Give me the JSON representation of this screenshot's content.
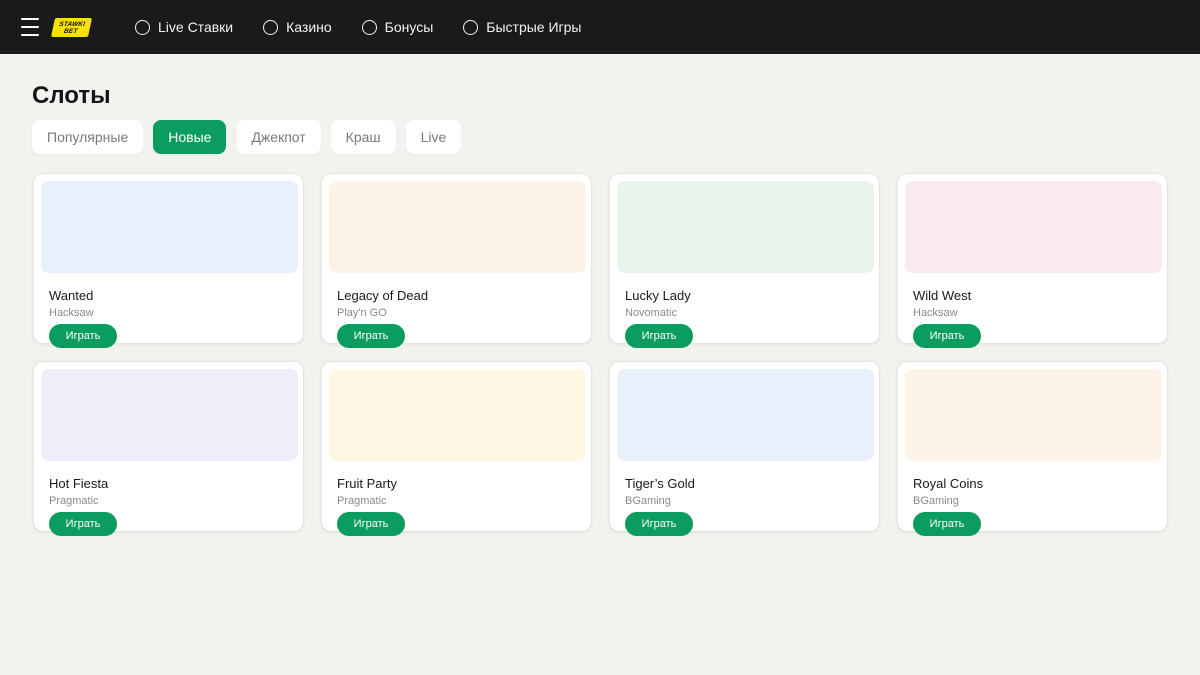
{
  "header": {
    "logo_lines": [
      "STAWKI",
      "BET"
    ],
    "nav": [
      {
        "label": "Live Ставки"
      },
      {
        "label": "Казино"
      },
      {
        "label": "Бонусы"
      },
      {
        "label": "Быстрые Игры"
      }
    ]
  },
  "page_title": "Слоты",
  "tabs": [
    {
      "label": "Популярные",
      "active": false
    },
    {
      "label": "Новые",
      "active": true
    },
    {
      "label": "Джекпот",
      "active": false
    },
    {
      "label": "Краш",
      "active": false
    },
    {
      "label": "Live",
      "active": false
    }
  ],
  "play_label": "Играть",
  "games": [
    {
      "title": "Wanted",
      "provider": "Hacksaw",
      "color": "#e9f0fb"
    },
    {
      "title": "Legacy of Dead",
      "provider": "Play'n GO",
      "color": "#fdf2e6"
    },
    {
      "title": "Lucky Lady",
      "provider": "Novomatic",
      "color": "#e8f4ec"
    },
    {
      "title": "Wild West",
      "provider": "Hacksaw",
      "color": "#f9eaee"
    },
    {
      "title": "Hot Fiesta",
      "provider": "Pragmatic",
      "color": "#efedf9"
    },
    {
      "title": "Fruit Party",
      "provider": "Pragmatic",
      "color": "#fdf7e4"
    },
    {
      "title": "Tiger’s Gold",
      "provider": "BGaming",
      "color": "#e9f0fb"
    },
    {
      "title": "Royal Coins",
      "provider": "BGaming",
      "color": "#fdf3e6"
    }
  ],
  "colors": {
    "accent": "#0a9d5f",
    "header_bg": "#1a1a1a",
    "logo_yellow": "#f6e100"
  }
}
